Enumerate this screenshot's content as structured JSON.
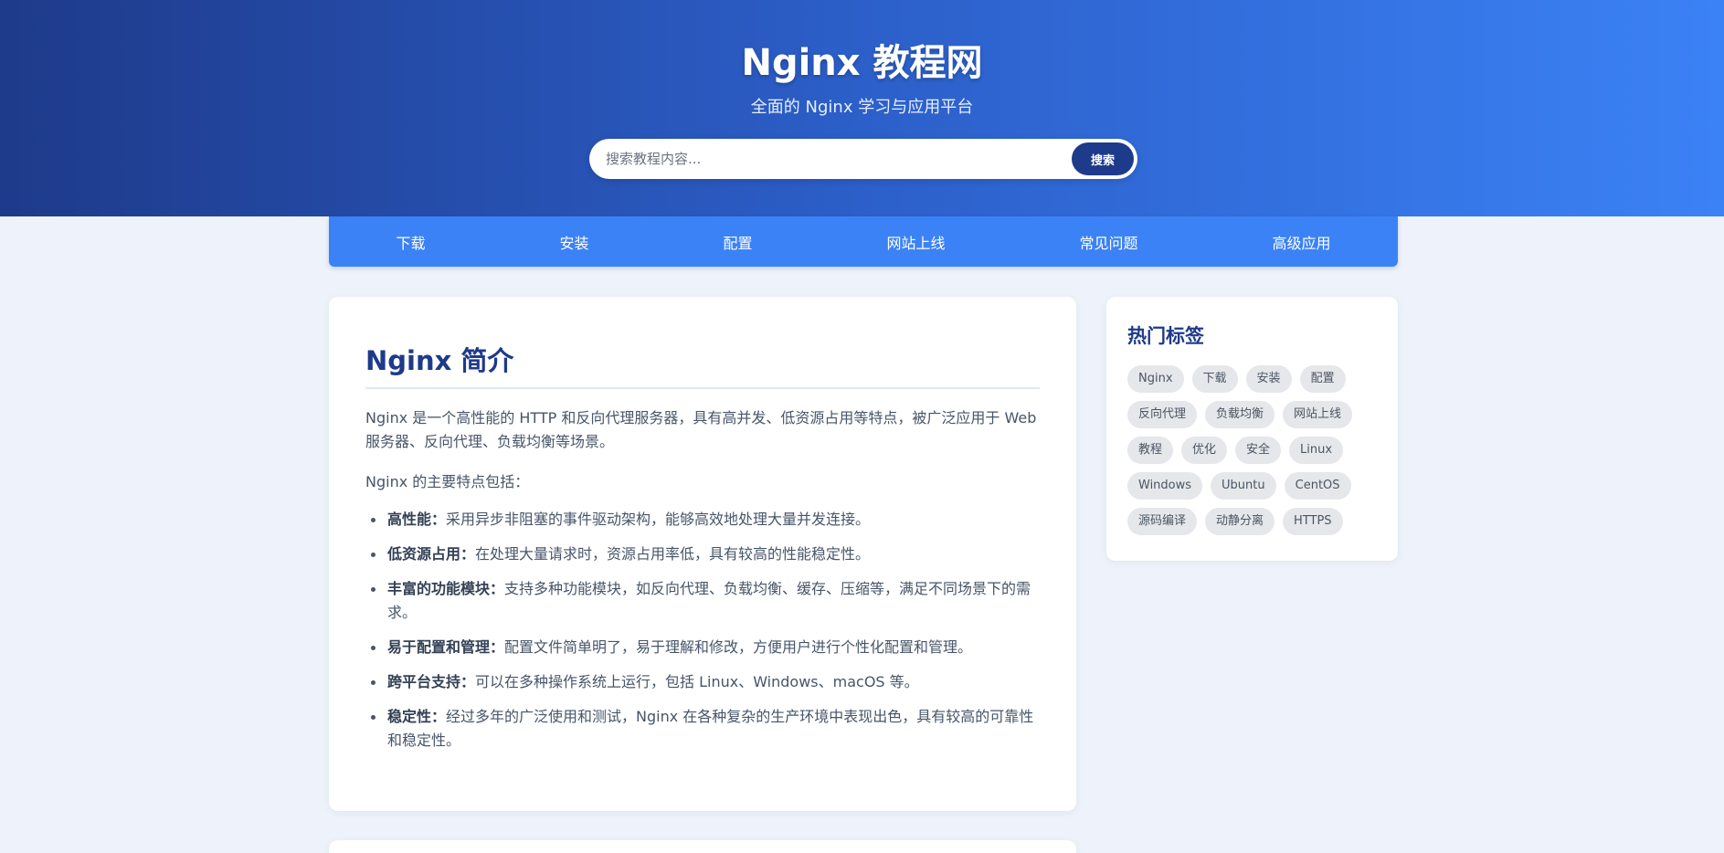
{
  "header": {
    "title": "Nginx 教程网",
    "subtitle": "全面的 Nginx 学习与应用平台",
    "search_placeholder": "搜索教程内容...",
    "search_button": "搜索"
  },
  "nav": {
    "items": [
      "下载",
      "安装",
      "配置",
      "网站上线",
      "常见问题",
      "高级应用"
    ]
  },
  "main": {
    "title": "Nginx 简介",
    "intro": "Nginx 是一个高性能的 HTTP 和反向代理服务器，具有高并发、低资源占用等特点，被广泛应用于 Web 服务器、反向代理、负载均衡等场景。",
    "features_heading": "Nginx 的主要特点包括：",
    "features": [
      {
        "label": "高性能：",
        "text": "采用异步非阻塞的事件驱动架构，能够高效地处理大量并发连接。"
      },
      {
        "label": "低资源占用：",
        "text": "在处理大量请求时，资源占用率低，具有较高的性能稳定性。"
      },
      {
        "label": "丰富的功能模块：",
        "text": "支持多种功能模块，如反向代理、负载均衡、缓存、压缩等，满足不同场景下的需求。"
      },
      {
        "label": "易于配置和管理：",
        "text": "配置文件简单明了，易于理解和修改，方便用户进行个性化配置和管理。"
      },
      {
        "label": "跨平台支持：",
        "text": "可以在多种操作系统上运行，包括 Linux、Windows、macOS 等。"
      },
      {
        "label": "稳定性：",
        "text": "经过多年的广泛使用和测试，Nginx 在各种复杂的生产环境中表现出色，具有较高的可靠性和稳定性。"
      }
    ]
  },
  "sidebar": {
    "title": "热门标签",
    "tags": [
      "Nginx",
      "下载",
      "安装",
      "配置",
      "反向代理",
      "负载均衡",
      "网站上线",
      "教程",
      "优化",
      "安全",
      "Linux",
      "Windows",
      "Ubuntu",
      "CentOS",
      "源码编译",
      "动静分离",
      "HTTPS"
    ]
  },
  "colors": {
    "header_gradient_start": "#1e3a8a",
    "header_gradient_end": "#3b82f6",
    "nav_bg": "#3b82f6",
    "accent": "#1e3a8a",
    "page_bg": "#eef3fb"
  }
}
